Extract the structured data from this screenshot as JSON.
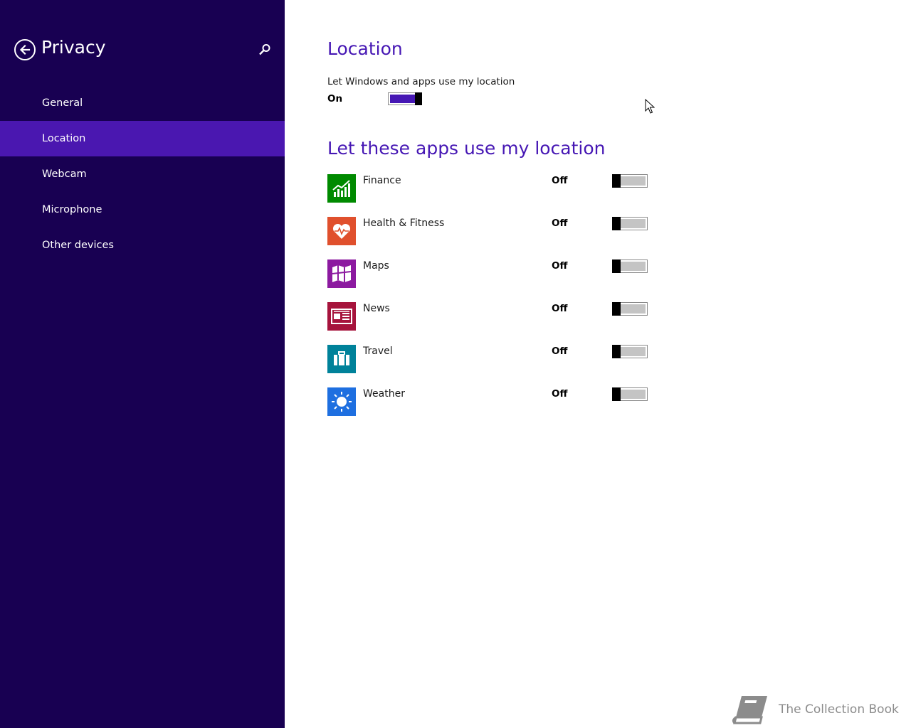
{
  "sidebar": {
    "title": "Privacy",
    "back_icon": "back-arrow-icon",
    "search_icon": "search-icon",
    "items": [
      {
        "label": "General",
        "active": false
      },
      {
        "label": "Location",
        "active": true
      },
      {
        "label": "Webcam",
        "active": false
      },
      {
        "label": "Microphone",
        "active": false
      },
      {
        "label": "Other devices",
        "active": false
      }
    ]
  },
  "main": {
    "title": "Location",
    "location_setting": {
      "label": "Let Windows and apps use my location",
      "state": "On"
    },
    "apps_heading": "Let these apps use my location",
    "apps": [
      {
        "name": "Finance",
        "state": "Off",
        "tile_color": "#008a00",
        "icon": "finance-chart-icon"
      },
      {
        "name": "Health & Fitness",
        "state": "Off",
        "tile_color": "#e0502d",
        "icon": "heart-pulse-icon"
      },
      {
        "name": "Maps",
        "state": "Off",
        "tile_color": "#8c1aa0",
        "icon": "map-icon"
      },
      {
        "name": "News",
        "state": "Off",
        "tile_color": "#a6143c",
        "icon": "newspaper-icon"
      },
      {
        "name": "Travel",
        "state": "Off",
        "tile_color": "#00829a",
        "icon": "suitcase-icon"
      },
      {
        "name": "Weather",
        "state": "Off",
        "tile_color": "#1e6fe0",
        "icon": "sun-icon"
      }
    ]
  },
  "colors": {
    "sidebar_bg": "#180052",
    "sidebar_active": "#4a17b0",
    "accent": "#4617b4"
  },
  "watermark": {
    "text": "The Collection Book",
    "icon": "book-icon"
  }
}
